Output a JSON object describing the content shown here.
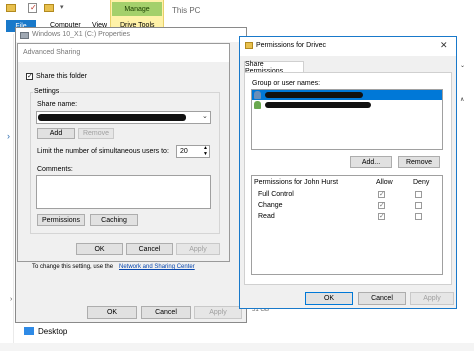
{
  "explorer": {
    "tabs": [
      "File",
      "Computer",
      "View"
    ],
    "manage_tab": "Manage",
    "drive_tools_label": "Drive Tools",
    "window_title": "This PC",
    "size_fragment": "51 GB",
    "nav_desktop": "Desktop"
  },
  "properties": {
    "title": "Windows 10_X1 (C:) Properties",
    "info_text": "To change this setting, use the",
    "link_text": "Network and Sharing Center",
    "ok": "OK",
    "cancel": "Cancel",
    "apply": "Apply"
  },
  "advanced": {
    "title": "Advanced Sharing",
    "share_checkbox_label": "Share this folder",
    "settings_label": "Settings",
    "share_name_label": "Share name:",
    "add": "Add",
    "remove": "Remove",
    "limit_label": "Limit the number of simultaneous users to:",
    "limit_value": "20",
    "comments_label": "Comments:",
    "permissions_button": "Permissions",
    "caching_button": "Caching",
    "ok": "OK",
    "cancel": "Cancel",
    "apply": "Apply"
  },
  "permissions": {
    "title": "Permissions for Drivec",
    "tab": "Share Permissions",
    "group_label": "Group or user names:",
    "add": "Add...",
    "remove": "Remove",
    "perm_for_label": "Permissions for John Hurst",
    "allow_header": "Allow",
    "deny_header": "Deny",
    "rows": [
      {
        "name": "Full Control",
        "allow": true,
        "deny": false
      },
      {
        "name": "Change",
        "allow": true,
        "deny": false
      },
      {
        "name": "Read",
        "allow": true,
        "deny": false
      }
    ],
    "ok": "OK",
    "cancel": "Cancel",
    "apply": "Apply",
    "close_glyph": "✕"
  }
}
